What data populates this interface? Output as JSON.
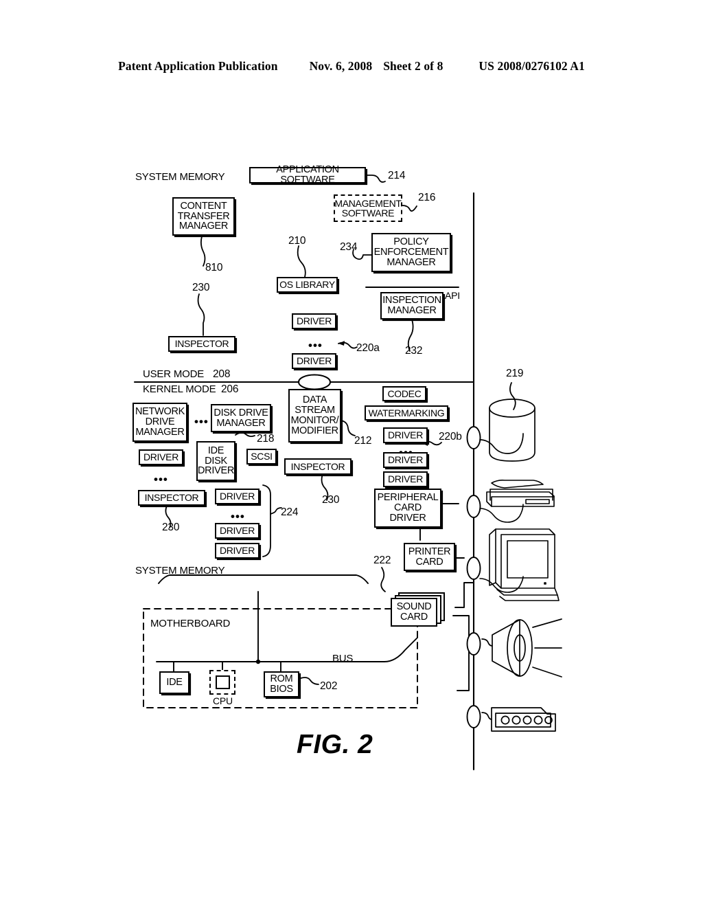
{
  "header": {
    "publication": "Patent Application Publication",
    "date": "Nov. 6, 2008",
    "sheet": "Sheet 2 of 8",
    "patent_number": "US 2008/0276102 A1"
  },
  "figure": {
    "caption": "FIG. 2",
    "labels": {
      "system_memory_top": "SYSTEM MEMORY",
      "system_memory_bottom": "SYSTEM MEMORY",
      "user_mode": "USER MODE",
      "user_mode_ref": "208",
      "kernel_mode": "KERNEL MODE",
      "kernel_mode_ref": "206",
      "api": "API",
      "motherboard": "MOTHERBOARD",
      "bus": "BUS",
      "cpu": "CPU"
    },
    "boxes": {
      "application_software": "APPLICATION SOFTWARE",
      "management_software": "MANAGEMENT\nSOFTWARE",
      "content_transfer_manager": "CONTENT\nTRANSFER\nMANAGER",
      "policy_enforcement_manager": "POLICY\nENFORCEMENT\nMANAGER",
      "os_library": "OS LIBRARY",
      "inspection_manager": "INSPECTION\nMANAGER",
      "inspector_user": "INSPECTOR",
      "driver_user_1": "DRIVER",
      "driver_user_2": "DRIVER",
      "network_drive_manager": "NETWORK\nDRIVE\nMANAGER",
      "disk_drive_manager": "DISK DRIVE\nMANAGER",
      "ide_disk_driver": "IDE\nDISK\nDRIVER",
      "scsi": "SCSI",
      "driver_net": "DRIVER",
      "inspector_net": "INSPECTOR",
      "driver_disk_1": "DRIVER",
      "driver_disk_2": "DRIVER",
      "driver_disk_3": "DRIVER",
      "data_stream_monitor": "DATA\nSTREAM\nMONITOR/\nMODIFIER",
      "inspector_dsm": "INSPECTOR",
      "codec": "CODEC",
      "watermarking": "WATERMARKING",
      "driver_periph_1": "DRIVER",
      "driver_periph_2": "DRIVER",
      "driver_periph_3": "DRIVER",
      "peripheral_card_driver": "PERIPHERAL\nCARD\nDRIVER",
      "printer_card": "PRINTER\nCARD",
      "sound_card": "SOUND\nCARD",
      "ide": "IDE",
      "rom_bios": "ROM\nBIOS"
    },
    "reference_numerals": {
      "application_software": "214",
      "management_software": "216",
      "content_transfer_manager": "810",
      "policy_enforcement_manager": "234",
      "os_library": "210",
      "inspection_manager": "232",
      "inspector_user": "230",
      "drivers_user": "220a",
      "disk_drive_manager": "218",
      "inspector_net": "230",
      "drivers_disk": "224",
      "data_stream_monitor": "212",
      "inspector_dsm": "230",
      "drivers_peripheral": "220b",
      "sound_card": "222",
      "rom_bios": "202",
      "storage_device": "219"
    }
  }
}
